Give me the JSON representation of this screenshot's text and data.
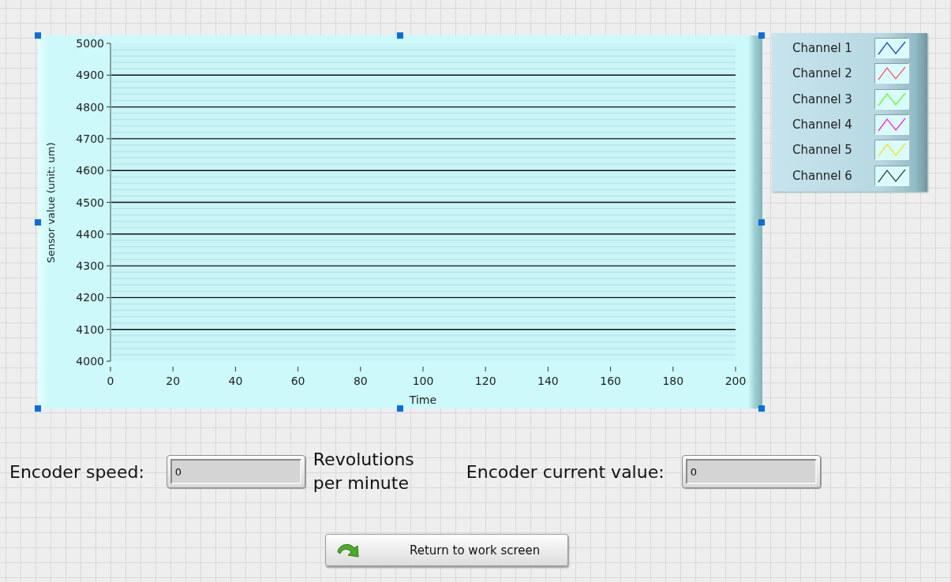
{
  "chart": {
    "chart_data": {
      "type": "line",
      "grid": true,
      "xlabel": "Time",
      "ylabel": "Sensor value (unit: um)",
      "xlim": [
        0,
        200
      ],
      "ylim": [
        4000,
        5000
      ],
      "xticks": [
        0,
        20,
        40,
        60,
        80,
        100,
        120,
        140,
        160,
        180,
        200
      ],
      "yticks": [
        4000,
        4100,
        4200,
        4300,
        4400,
        4500,
        4600,
        4700,
        4800,
        4900,
        5000
      ],
      "ref_lines": [
        {
          "axis": "y",
          "value": 4020
        },
        {
          "axis": "y",
          "value": 4040
        },
        {
          "axis": "y",
          "value": 4060
        },
        {
          "axis": "y",
          "value": 4080
        },
        {
          "axis": "y",
          "value": 4120
        },
        {
          "axis": "y",
          "value": 4140
        },
        {
          "axis": "y",
          "value": 4160
        },
        {
          "axis": "y",
          "value": 4180
        },
        {
          "axis": "y",
          "value": 4220
        },
        {
          "axis": "y",
          "value": 4240
        },
        {
          "axis": "y",
          "value": 4260
        },
        {
          "axis": "y",
          "value": 4280
        },
        {
          "axis": "y",
          "value": 4320
        },
        {
          "axis": "y",
          "value": 4340
        },
        {
          "axis": "y",
          "value": 4360
        },
        {
          "axis": "y",
          "value": 4380
        },
        {
          "axis": "y",
          "value": 4420
        },
        {
          "axis": "y",
          "value": 4440
        },
        {
          "axis": "y",
          "value": 4460
        },
        {
          "axis": "y",
          "value": 4480
        },
        {
          "axis": "y",
          "value": 4520
        },
        {
          "axis": "y",
          "value": 4540
        },
        {
          "axis": "y",
          "value": 4560
        },
        {
          "axis": "y",
          "value": 4580
        },
        {
          "axis": "y",
          "value": 4620
        },
        {
          "axis": "y",
          "value": 4640
        },
        {
          "axis": "y",
          "value": 4660
        },
        {
          "axis": "y",
          "value": 4680
        },
        {
          "axis": "y",
          "value": 4720
        },
        {
          "axis": "y",
          "value": 4740
        },
        {
          "axis": "y",
          "value": 4760
        },
        {
          "axis": "y",
          "value": 4780
        },
        {
          "axis": "y",
          "value": 4820
        },
        {
          "axis": "y",
          "value": 4840
        },
        {
          "axis": "y",
          "value": 4860
        },
        {
          "axis": "y",
          "value": 4880
        },
        {
          "axis": "y",
          "value": 4920
        },
        {
          "axis": "y",
          "value": 4940
        },
        {
          "axis": "y",
          "value": 4960
        },
        {
          "axis": "y",
          "value": 4980
        }
      ]
    }
  },
  "legend": [
    {
      "name": "Channel 1",
      "color": "#1a3cff"
    },
    {
      "name": "Channel 2",
      "color": "#ff5a5a"
    },
    {
      "name": "Channel 3",
      "color": "#66ff22"
    },
    {
      "name": "Channel 4",
      "color": "#ff22dd"
    },
    {
      "name": "Channel 5",
      "color": "#f5e51a"
    },
    {
      "name": "Channel 6",
      "color": "#444444"
    }
  ],
  "encoder_speed": {
    "label": "Encoder speed:",
    "value": "0",
    "unit": "Revolutions per minute"
  },
  "encoder_current": {
    "label": "Encoder current value:",
    "value": "0"
  },
  "button": {
    "label": "Return to work screen"
  }
}
